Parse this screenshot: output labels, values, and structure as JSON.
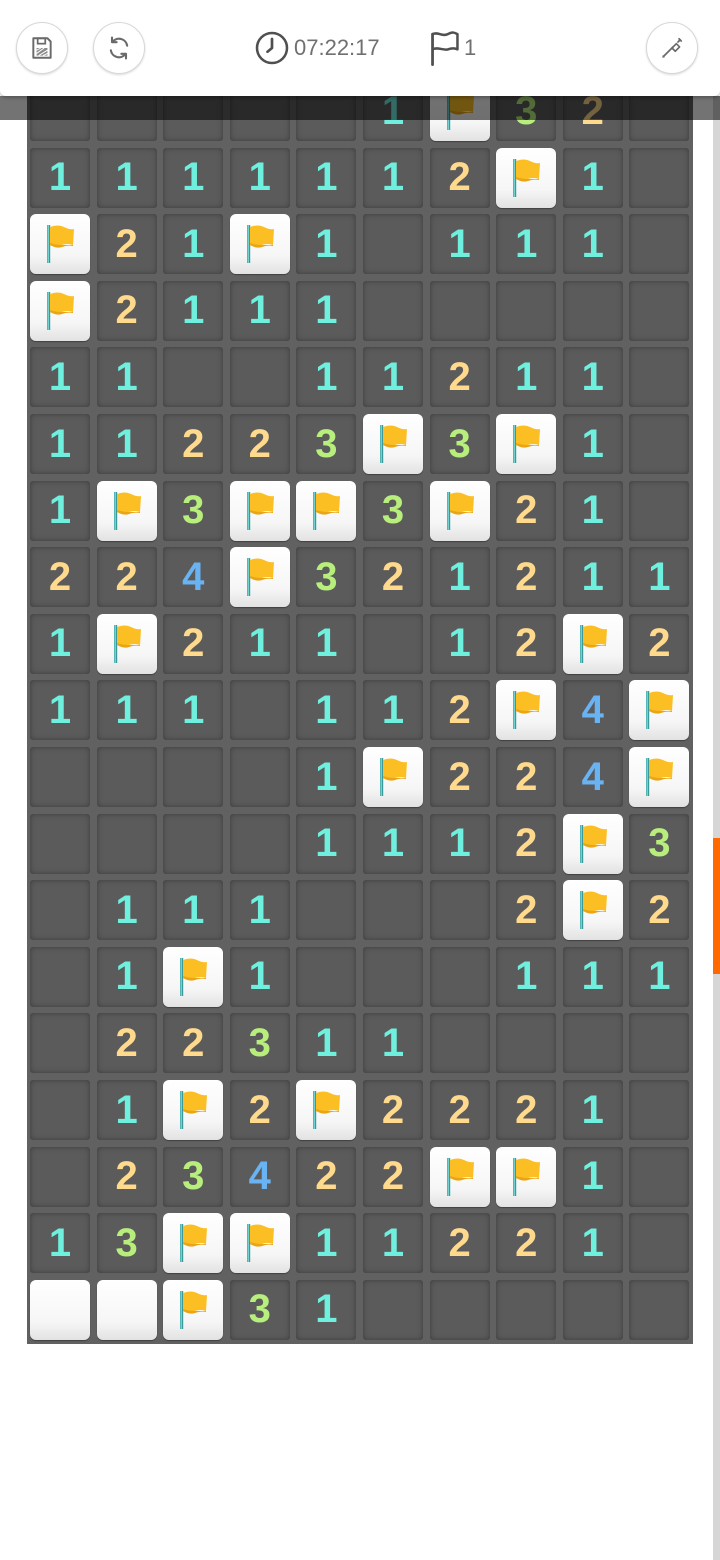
{
  "toolbar": {
    "save_icon": "save-icon",
    "restart_icon": "refresh-icon",
    "timer_icon": "clock-icon",
    "timer": "07:22:17",
    "flag_icon": "flag-outline-icon",
    "flag_count": "1",
    "dig_icon": "shovel-icon"
  },
  "colors": {
    "number_1": "#6ff0de",
    "number_2": "#ffd98c",
    "number_3": "#b7ee7c",
    "number_4": "#6ab3f2",
    "flag": "#fbbf24",
    "board": "#616161",
    "scroll_thumb": "#ff6a00"
  },
  "board": {
    "columns": 10,
    "legend": "digits = revealed count, F = flag on raised tile, U = unrevealed raised tile, _ = revealed empty",
    "rows": [
      [
        "_",
        "_",
        "_",
        "_",
        "_",
        "1",
        "F",
        "3",
        "2",
        "_"
      ],
      [
        "1",
        "1",
        "1",
        "1",
        "1",
        "1",
        "2",
        "F",
        "1",
        "_"
      ],
      [
        "F",
        "2",
        "1",
        "F",
        "1",
        "_",
        "1",
        "1",
        "1",
        "_"
      ],
      [
        "F",
        "2",
        "1",
        "1",
        "1",
        "_",
        "_",
        "_",
        "_",
        "_"
      ],
      [
        "1",
        "1",
        "_",
        "_",
        "1",
        "1",
        "2",
        "1",
        "1",
        "_"
      ],
      [
        "1",
        "1",
        "2",
        "2",
        "3",
        "F",
        "3",
        "F",
        "1",
        "_"
      ],
      [
        "1",
        "F",
        "3",
        "F",
        "F",
        "3",
        "F",
        "2",
        "1",
        "_"
      ],
      [
        "2",
        "2",
        "4",
        "F",
        "3",
        "2",
        "1",
        "2",
        "1",
        "1"
      ],
      [
        "1",
        "F",
        "2",
        "1",
        "1",
        "_",
        "1",
        "2",
        "F",
        "2"
      ],
      [
        "1",
        "1",
        "1",
        "_",
        "1",
        "1",
        "2",
        "F",
        "4",
        "F"
      ],
      [
        "_",
        "_",
        "_",
        "_",
        "1",
        "F",
        "2",
        "2",
        "4",
        "F"
      ],
      [
        "_",
        "_",
        "_",
        "_",
        "1",
        "1",
        "1",
        "2",
        "F",
        "3"
      ],
      [
        "_",
        "1",
        "1",
        "1",
        "_",
        "_",
        "_",
        "2",
        "F",
        "2"
      ],
      [
        "_",
        "1",
        "F",
        "1",
        "_",
        "_",
        "_",
        "1",
        "1",
        "1"
      ],
      [
        "_",
        "2",
        "2",
        "3",
        "1",
        "1",
        "_",
        "_",
        "_",
        "_"
      ],
      [
        "_",
        "1",
        "F",
        "2",
        "F",
        "2",
        "2",
        "2",
        "1",
        "_"
      ],
      [
        "_",
        "2",
        "3",
        "4",
        "2",
        "2",
        "F",
        "F",
        "1",
        "_"
      ],
      [
        "1",
        "3",
        "F",
        "F",
        "1",
        "1",
        "2",
        "2",
        "1",
        "_"
      ],
      [
        "U",
        "U",
        "F",
        "3",
        "1",
        "_",
        "_",
        "_",
        "_",
        "_"
      ]
    ]
  }
}
